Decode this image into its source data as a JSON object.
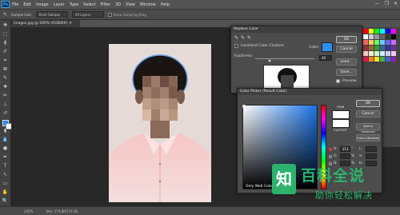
{
  "menubar": {
    "logo": "Ps",
    "items": [
      "File",
      "Edit",
      "Image",
      "Layer",
      "Type",
      "Select",
      "Filter",
      "3D",
      "View",
      "Window",
      "Help"
    ],
    "window_controls": [
      "—",
      "❐",
      "✕"
    ]
  },
  "options_bar": {
    "sample_size_label": "Sample Size:",
    "sample_size_value": "Point Sample",
    "all_layers": "All Layers",
    "show_sampling_ring": "Show Sampling Ring"
  },
  "document": {
    "tab_title": "images.jpg @ 200% (RGB/8#) ✕",
    "status_zoom": "200%",
    "status_doc": "Doc: 174.8K/174.8K"
  },
  "replace_color": {
    "title": "Replace Color",
    "localized_label": "Localized Color Clusters",
    "color_label": "Color:",
    "fuzziness_label": "Fuzziness:",
    "fuzziness_value": "40",
    "selection_label": "Selection",
    "image_label": "Image",
    "preview_label": "Preview",
    "ok": "OK",
    "cancel": "Cancel",
    "load": "Load...",
    "save": "Save...",
    "result_color": "#2f8ff0"
  },
  "color_picker": {
    "title": "Color Picker (Result Color)",
    "ok": "OK",
    "cancel": "Cancel",
    "add_to_swatches": "Add to Swatches",
    "color_libraries": "Color Libraries",
    "new_label": "new",
    "current_label": "current",
    "only_web_colors": "Only Web Colors",
    "fields": [
      {
        "label": "H:",
        "value": "211",
        "unit": "°"
      },
      {
        "label": "S:",
        "value": "",
        "unit": "%"
      },
      {
        "label": "B:",
        "value": "",
        "unit": "%"
      },
      {
        "label": "R:",
        "value": "",
        "unit": ""
      },
      {
        "label": "G:",
        "value": "",
        "unit": ""
      },
      {
        "label": "B:",
        "value": "",
        "unit": ""
      }
    ],
    "lab_fields": [
      {
        "label": "L:",
        "value": ""
      },
      {
        "label": "a:",
        "value": ""
      },
      {
        "label": "b:",
        "value": ""
      }
    ],
    "new_color": "#ffffff",
    "current_color": "#ffffff"
  },
  "watermark": {
    "title": "百科全说",
    "subtitle": "助你轻松解决",
    "logo": "知"
  },
  "colors": {
    "ps_blue": "#31a8ff",
    "watermark_green": "#2cb26b",
    "foreground": "#1e90ff",
    "background": "#ffffff"
  }
}
